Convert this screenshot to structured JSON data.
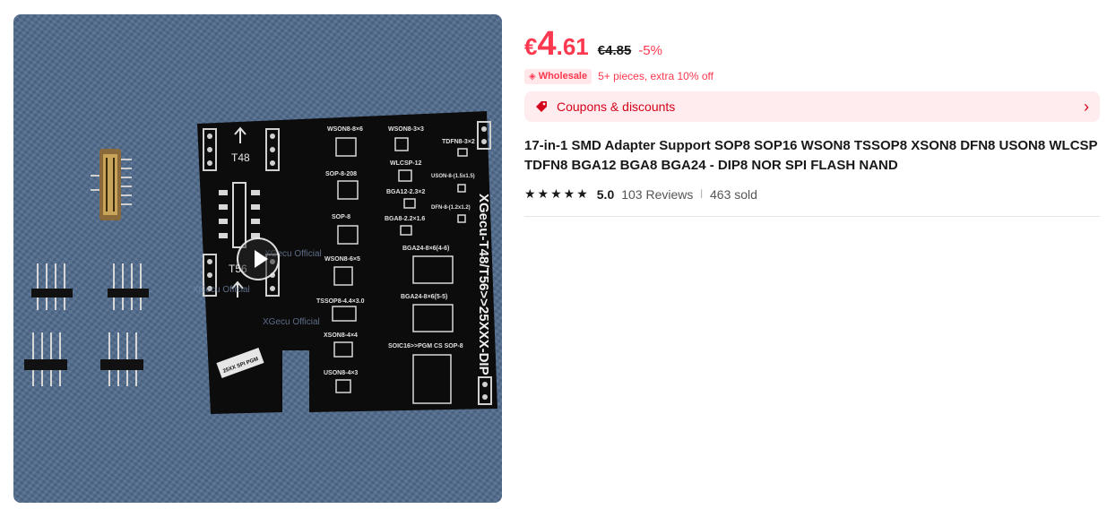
{
  "gallery": {
    "watermarks": [
      "XGecu Official",
      "XGecu Official",
      "XGecu Official"
    ],
    "board_labels": {
      "side_title": "XGecu-T48/T56>>25XXX-DIP",
      "t48": "T48",
      "t56": "T56",
      "wson8_8x6": "WSON8-8×6",
      "wson8_3x3": "WSON8-3×3",
      "tdfn8": "TDFN8-3×2",
      "sop8_208": "SOP-8-208",
      "wlcsp": "WLCSP-12",
      "uson8_15": "USON-8-(1.5x1.5)",
      "bga12": "BGA12-2.3×2",
      "dfn8": "DFN-8-(1.2x1.2)",
      "sop8": "SOP-8",
      "bga8": "BGA8-2.2×1.6",
      "wson8_6x5": "WSON8-6×5",
      "bga24_46": "BGA24-8×6(4-6)",
      "tssop8": "TSSOP8-4.4×3.0",
      "bga24_55": "BGA24-8×6(5-5)",
      "xson8": "XSON8-4×4",
      "soic16": "SOIC16>>PGM CS SOP-8",
      "uson8_43": "USON8-4×3",
      "chip_label": "25XX SPI PGM"
    }
  },
  "price": {
    "currency": "€",
    "integer": "4",
    "decimal": ".61",
    "original": "€4.85",
    "discount": "-5%"
  },
  "wholesale": {
    "badge": "Wholesale",
    "text": "5+ pieces, extra 10% off"
  },
  "coupons": {
    "label": "Coupons & discounts"
  },
  "product": {
    "title": "17-in-1 SMD Adapter Support SOP8 SOP16 WSON8 TSSOP8 XSON8 DFN8 USON8 WLCSP TDFN8 BGA12 BGA8 BGA24 - DIP8 NOR SPI FLASH NAND"
  },
  "rating": {
    "stars": "★★★★★",
    "score": "5.0",
    "reviews": "103 Reviews",
    "sold": "463 sold"
  },
  "colors": {
    "accent": "#fd384f",
    "coupon_text": "#d3031c",
    "coupon_bg": "#ffecee"
  }
}
